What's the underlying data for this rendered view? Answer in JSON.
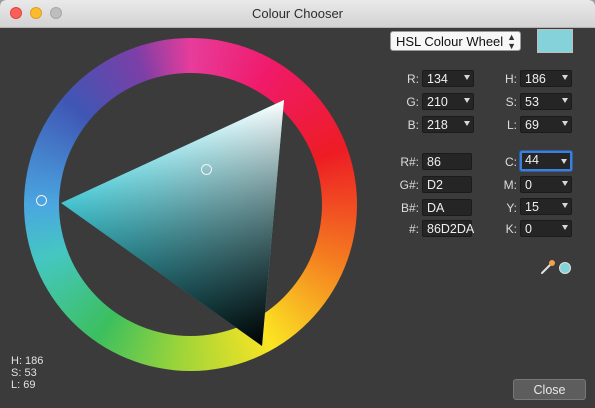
{
  "window": {
    "title": "Colour Chooser"
  },
  "header": {
    "mode_select": {
      "value": "HSL Colour Wheel",
      "options": [
        "HSL Colour Wheel"
      ]
    },
    "current_colour": "#86D2DA"
  },
  "wheel_readout": {
    "h": "H: 186",
    "s": "S: 53",
    "l": "L: 69"
  },
  "rgb": {
    "r": {
      "label": "R:",
      "value": "134"
    },
    "g": {
      "label": "G:",
      "value": "210"
    },
    "b": {
      "label": "B:",
      "value": "218"
    }
  },
  "hsl": {
    "h": {
      "label": "H:",
      "value": "186"
    },
    "s": {
      "label": "S:",
      "value": "53"
    },
    "l": {
      "label": "L:",
      "value": "69"
    }
  },
  "hex": {
    "r": {
      "label": "R#:",
      "value": "86"
    },
    "g": {
      "label": "G#:",
      "value": "D2"
    },
    "b": {
      "label": "B#:",
      "value": "DA"
    },
    "all": {
      "label": "#:",
      "value": "86D2DA"
    }
  },
  "cmyk": {
    "c": {
      "label": "C:",
      "value": "44"
    },
    "m": {
      "label": "M:",
      "value": "0"
    },
    "y": {
      "label": "Y:",
      "value": "15"
    },
    "k": {
      "label": "K:",
      "value": "0"
    }
  },
  "icons": {
    "eyedropper": "eyedropper-icon",
    "preview": "colour-preview-dot",
    "dropdown": "chevron-down-icon"
  },
  "colors": {
    "hue_vertex": "#45c7d3",
    "selection_outline": "#3f7fd9"
  },
  "footer": {
    "close_label": "Close"
  }
}
